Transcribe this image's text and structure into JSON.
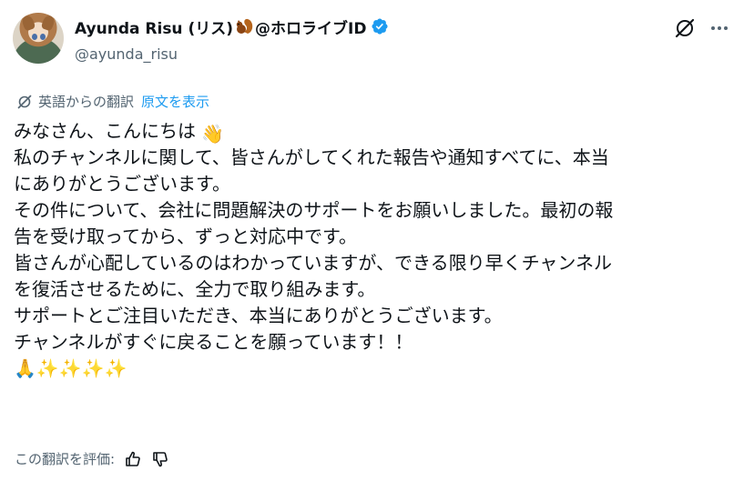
{
  "author": {
    "name_part1": "Ayunda Risu (リス)",
    "name_part2": "@ホロライブID",
    "handle": "@ayunda_risu",
    "verified_color": "#1d9bf0"
  },
  "icons": {
    "squirrel": "squirrel-emoji",
    "verified": "verified-badge-icon",
    "grok": "grok-icon",
    "more": "more-icon",
    "translate": "translate-icon",
    "thumbs_up": "thumbs-up-icon",
    "thumbs_down": "thumbs-down-icon"
  },
  "translation": {
    "label": "英語からの翻訳",
    "show_original": "原文を表示"
  },
  "tweet": {
    "lines": [
      "みなさん、こんにちは",
      "私のチャンネルに関して、皆さんがしてくれた報告や通知すべてに、本当",
      "にありがとうございます。",
      "その件について、会社に問題解決のサポートをお願いしました。最初の報",
      "告を受け取ってから、ずっと対応中です。",
      "皆さんが心配しているのはわかっていますが、できる限り早くチャンネル",
      "を復活させるために、全力で取り組みます。",
      "サポートとご注目いただき、本当にありがとうございます。",
      "チャンネルがすぐに戻ることを願っています！！"
    ],
    "emoji_wave": "👋",
    "emoji_line": "🙏✨✨✨✨"
  },
  "rating": {
    "label": "この翻訳を評価:"
  }
}
